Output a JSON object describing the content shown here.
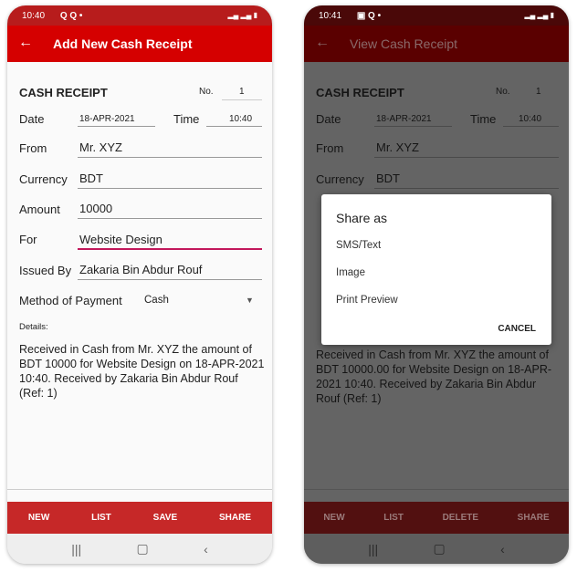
{
  "left": {
    "status_time": "10:40",
    "status_icons": "Q Q •",
    "title": "Add New Cash Receipt",
    "heading": "CASH RECEIPT",
    "no_label": "No.",
    "no_value": "1",
    "date_label": "Date",
    "date_value": "18-APR-2021",
    "time_label": "Time",
    "time_value": "10:40",
    "from_label": "From",
    "from_value": "Mr. XYZ",
    "currency_label": "Currency",
    "currency_value": "BDT",
    "amount_label": "Amount",
    "amount_value": "10000",
    "for_label": "For",
    "for_value": "Website Design",
    "issued_label": "Issued By",
    "issued_value": "Zakaria Bin Abdur Rouf",
    "method_label": "Method of Payment",
    "method_value": "Cash",
    "details_label": "Details:",
    "details_text": "Received in Cash from Mr. XYZ the amount of BDT 10000 for Website Design on 18-APR-2021 10:40. Received by Zakaria Bin Abdur Rouf (Ref: 1)",
    "buttons": [
      "NEW",
      "LIST",
      "SAVE",
      "SHARE"
    ]
  },
  "right": {
    "status_time": "10:41",
    "status_icons": "▣ Q •",
    "title": "View Cash Receipt",
    "heading": "CASH RECEIPT",
    "no_label": "No.",
    "no_value": "1",
    "date_label": "Date",
    "date_value": "18-APR-2021",
    "time_label": "Time",
    "time_value": "10:40",
    "from_label": "From",
    "from_value": "Mr. XYZ",
    "currency_label": "Currency",
    "currency_value": "BDT",
    "details_text": "Received in Cash from Mr. XYZ the amount of BDT 10000.00 for Website Design on 18-APR-2021 10:40. Received by Zakaria Bin Abdur Rouf (Ref: 1)",
    "buttons": [
      "NEW",
      "LIST",
      "DELETE",
      "SHARE"
    ],
    "dialog": {
      "title": "Share as",
      "options": [
        "SMS/Text",
        "Image",
        "Print Preview"
      ],
      "cancel": "CANCEL"
    }
  },
  "colors": {
    "primary": "#d50000",
    "status": "#b71c1c",
    "accent": "#c2185b"
  }
}
